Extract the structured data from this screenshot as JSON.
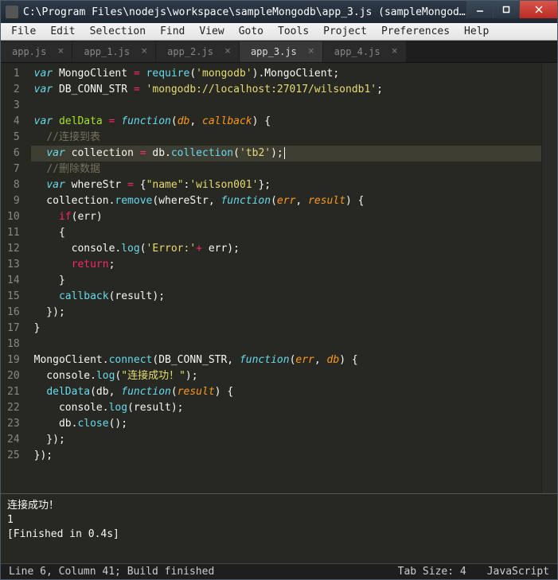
{
  "window": {
    "title": "C:\\Program Files\\nodejs\\workspace\\sampleMongodb\\app_3.js (sampleMongodb) - Sublime Text..."
  },
  "menu": [
    "File",
    "Edit",
    "Selection",
    "Find",
    "View",
    "Goto",
    "Tools",
    "Project",
    "Preferences",
    "Help"
  ],
  "tabs": [
    {
      "label": "app.js",
      "active": false
    },
    {
      "label": "app_1.js",
      "active": false
    },
    {
      "label": "app_2.js",
      "active": false
    },
    {
      "label": "app_3.js",
      "active": true
    },
    {
      "label": "app_4.js",
      "active": false
    }
  ],
  "code_lines": [
    [
      [
        "kw",
        "var"
      ],
      [
        "plain",
        " MongoClient "
      ],
      [
        "op",
        "="
      ],
      [
        "plain",
        " "
      ],
      [
        "call",
        "require"
      ],
      [
        "plain",
        "("
      ],
      [
        "str",
        "'mongodb'"
      ],
      [
        "plain",
        ")."
      ],
      [
        "plain",
        "MongoClient;"
      ]
    ],
    [
      [
        "kw",
        "var"
      ],
      [
        "plain",
        " DB_CONN_STR "
      ],
      [
        "op",
        "="
      ],
      [
        "plain",
        " "
      ],
      [
        "str",
        "'mongodb://localhost:27017/wilsondb1'"
      ],
      [
        "plain",
        ";"
      ]
    ],
    [],
    [
      [
        "kw",
        "var"
      ],
      [
        "plain",
        " "
      ],
      [
        "name",
        "delData"
      ],
      [
        "plain",
        " "
      ],
      [
        "op",
        "="
      ],
      [
        "plain",
        " "
      ],
      [
        "fn",
        "function"
      ],
      [
        "plain",
        "("
      ],
      [
        "param",
        "db"
      ],
      [
        "plain",
        ", "
      ],
      [
        "param",
        "callback"
      ],
      [
        "plain",
        ") {"
      ]
    ],
    [
      [
        "plain",
        "  "
      ],
      [
        "comment",
        "//连接到表"
      ]
    ],
    [
      [
        "plain",
        "  "
      ],
      [
        "kw",
        "var"
      ],
      [
        "plain",
        " collection "
      ],
      [
        "op",
        "="
      ],
      [
        "plain",
        " db."
      ],
      [
        "call",
        "collection"
      ],
      [
        "plain",
        "("
      ],
      [
        "str",
        "'tb2'"
      ],
      [
        "plain",
        ");"
      ]
    ],
    [
      [
        "plain",
        "  "
      ],
      [
        "comment",
        "//删除数据"
      ]
    ],
    [
      [
        "plain",
        "  "
      ],
      [
        "kw",
        "var"
      ],
      [
        "plain",
        " whereStr "
      ],
      [
        "op",
        "="
      ],
      [
        "plain",
        " {"
      ],
      [
        "str",
        "\"name\""
      ],
      [
        "plain",
        ":"
      ],
      [
        "str",
        "'wilson001'"
      ],
      [
        "plain",
        "};"
      ]
    ],
    [
      [
        "plain",
        "  collection."
      ],
      [
        "call",
        "remove"
      ],
      [
        "plain",
        "(whereStr, "
      ],
      [
        "fn",
        "function"
      ],
      [
        "plain",
        "("
      ],
      [
        "param",
        "err"
      ],
      [
        "plain",
        ", "
      ],
      [
        "param",
        "result"
      ],
      [
        "plain",
        ") {"
      ]
    ],
    [
      [
        "plain",
        "    "
      ],
      [
        "err",
        "if"
      ],
      [
        "plain",
        "(err)"
      ]
    ],
    [
      [
        "plain",
        "    {"
      ]
    ],
    [
      [
        "plain",
        "      console."
      ],
      [
        "call",
        "log"
      ],
      [
        "plain",
        "("
      ],
      [
        "str",
        "'Error:'"
      ],
      [
        "op",
        "+"
      ],
      [
        "plain",
        " err);"
      ]
    ],
    [
      [
        "plain",
        "      "
      ],
      [
        "err",
        "return"
      ],
      [
        "plain",
        ";"
      ]
    ],
    [
      [
        "plain",
        "    }"
      ]
    ],
    [
      [
        "plain",
        "    "
      ],
      [
        "call",
        "callback"
      ],
      [
        "plain",
        "(result);"
      ]
    ],
    [
      [
        "plain",
        "  });"
      ]
    ],
    [
      [
        "plain",
        "}"
      ]
    ],
    [],
    [
      [
        "plain",
        "MongoClient."
      ],
      [
        "call",
        "connect"
      ],
      [
        "plain",
        "(DB_CONN_STR, "
      ],
      [
        "fn",
        "function"
      ],
      [
        "plain",
        "("
      ],
      [
        "param",
        "err"
      ],
      [
        "plain",
        ", "
      ],
      [
        "param",
        "db"
      ],
      [
        "plain",
        ") {"
      ]
    ],
    [
      [
        "plain",
        "  console."
      ],
      [
        "call",
        "log"
      ],
      [
        "plain",
        "("
      ],
      [
        "str",
        "\"连接成功！\""
      ],
      [
        "plain",
        ");"
      ]
    ],
    [
      [
        "plain",
        "  "
      ],
      [
        "call",
        "delData"
      ],
      [
        "plain",
        "(db, "
      ],
      [
        "fn",
        "function"
      ],
      [
        "plain",
        "("
      ],
      [
        "param",
        "result"
      ],
      [
        "plain",
        ") {"
      ]
    ],
    [
      [
        "plain",
        "    console."
      ],
      [
        "call",
        "log"
      ],
      [
        "plain",
        "(result);"
      ]
    ],
    [
      [
        "plain",
        "    db."
      ],
      [
        "call",
        "close"
      ],
      [
        "plain",
        "();"
      ]
    ],
    [
      [
        "plain",
        "  });"
      ]
    ],
    [
      [
        "plain",
        "});"
      ]
    ]
  ],
  "selected_line_index": 5,
  "console_lines": [
    "连接成功！",
    "1",
    "[Finished in 0.4s]"
  ],
  "status": {
    "left": "Line 6, Column 41; Build finished",
    "tab_size": "Tab Size: 4",
    "syntax": "JavaScript"
  }
}
